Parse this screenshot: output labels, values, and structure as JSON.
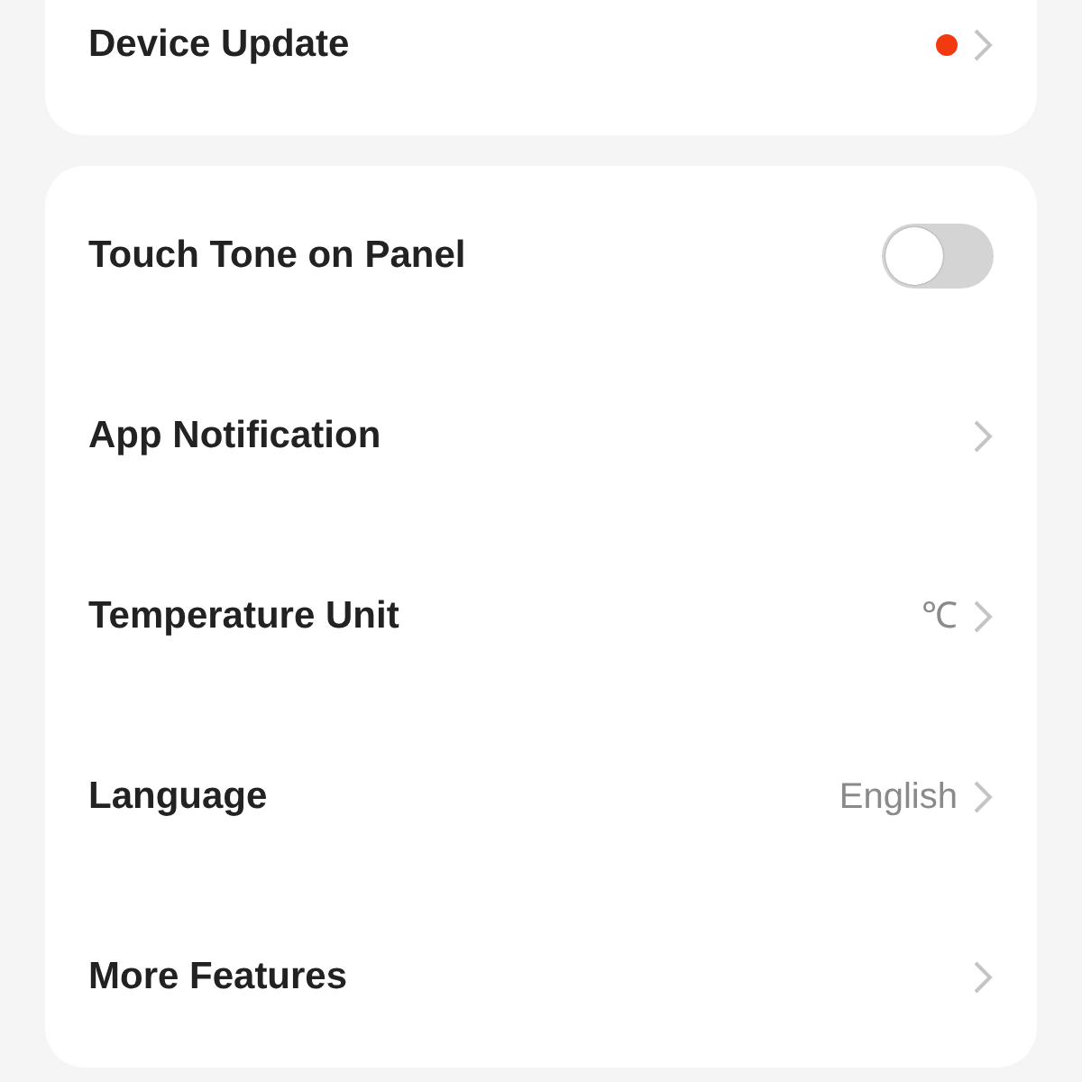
{
  "sections": [
    {
      "rows": [
        {
          "kind": "arrow",
          "label": "Device Update",
          "new_badge": true
        }
      ]
    },
    {
      "rows": [
        {
          "kind": "toggle",
          "label": "Touch Tone on Panel",
          "on": false
        },
        {
          "kind": "arrow",
          "label": "App Notification"
        },
        {
          "kind": "arrow",
          "label": "Temperature Unit",
          "value": "℃"
        },
        {
          "kind": "arrow",
          "label": "Language",
          "value": "English"
        },
        {
          "kind": "arrow",
          "label": "More Features"
        }
      ]
    }
  ]
}
